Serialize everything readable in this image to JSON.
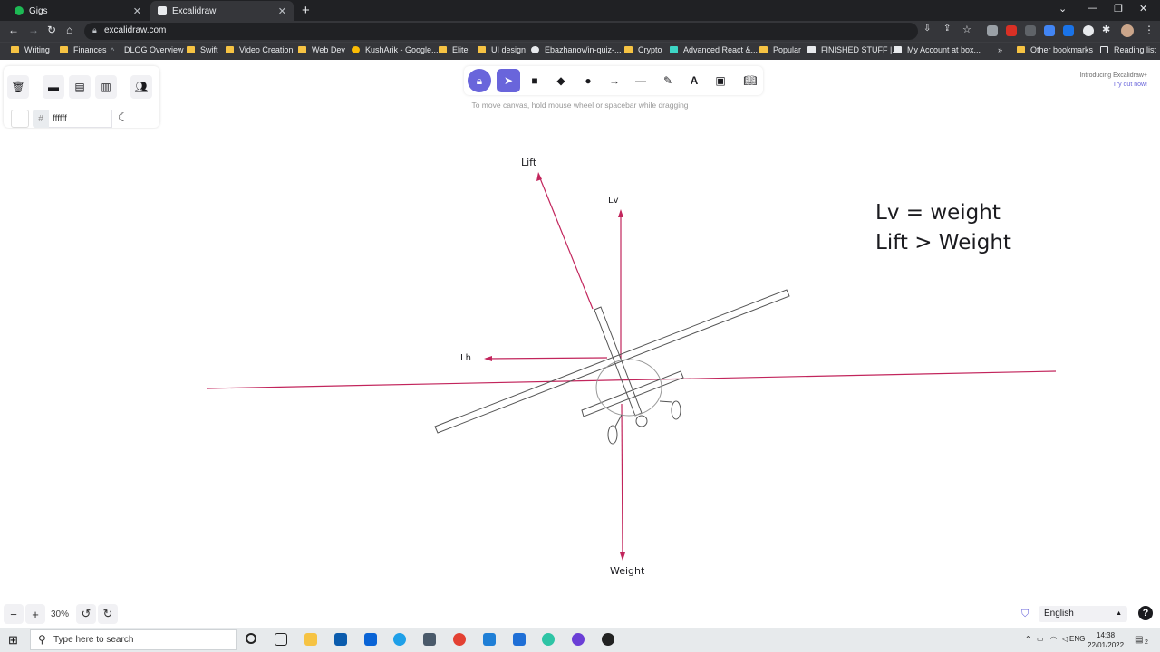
{
  "browser": {
    "tabs": [
      {
        "title": "Gigs",
        "color": "#1db954"
      },
      {
        "title": "Excalidraw",
        "color": "#e8eaed"
      }
    ],
    "url": "excalidraw.com",
    "bookmarks": [
      "Writing",
      "Finances",
      "DLOG Overview",
      "Swift",
      "Video Creation",
      "Web Dev",
      "KushArik - Google...",
      "Elite",
      "UI design",
      "Ebazhanov/in-quiz-...",
      "Crypto",
      "Advanced React &...",
      "Popular",
      "FINISHED STUFF |...",
      "My Account at box...",
      "Other bookmarks",
      "Reading list"
    ],
    "more_chevron": "»"
  },
  "left_panel": {
    "hash": "#",
    "background_color": "ffffff"
  },
  "toolbar": {
    "hint": "To move canvas, hold mouse wheel or spacebar while dragging",
    "accent": "#6965db"
  },
  "promo": {
    "line1": "Introducing Excalidraw+",
    "line2": "Try out now!"
  },
  "drawing": {
    "labels": {
      "lift": "Lift",
      "lv": "Lv",
      "lh": "Lh",
      "weight": "Weight"
    },
    "equations": {
      "line1": "Lv = weight",
      "line2": "Lift > Weight"
    },
    "arrow_color": "#c2255c"
  },
  "zoom": {
    "minus": "−",
    "plus": "+",
    "level": "30%"
  },
  "language": "English",
  "taskbar": {
    "search_placeholder": "Type here to search",
    "lang": "ENG",
    "time": "14:38",
    "date": "22/01/2022",
    "notifications": "2"
  }
}
